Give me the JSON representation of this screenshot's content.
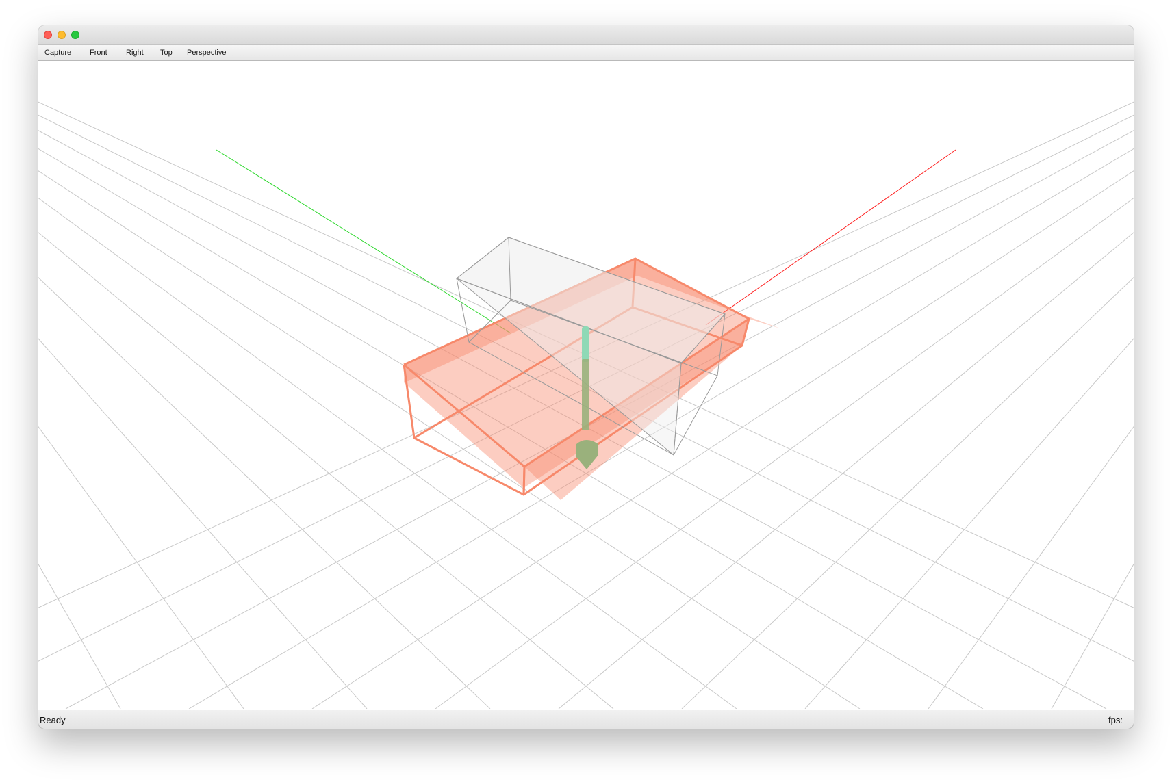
{
  "toolbar": {
    "capture_label": "Capture",
    "front_label": "Front",
    "right_label": "Right",
    "top_label": "Top",
    "perspective_label": "Perspective"
  },
  "status": {
    "message": "Ready",
    "fps_label": "fps:"
  },
  "scene": {
    "grid_color": "#c8c8c8",
    "x_axis_color": "#ff2020",
    "y_axis_color": "#2cd82c",
    "workpiece_color": "#f7896b",
    "machine_bounds_color": "#9a9a9a",
    "tool_shank_color": "#8fd9b6",
    "tool_tip_color": "#9ab17c"
  }
}
